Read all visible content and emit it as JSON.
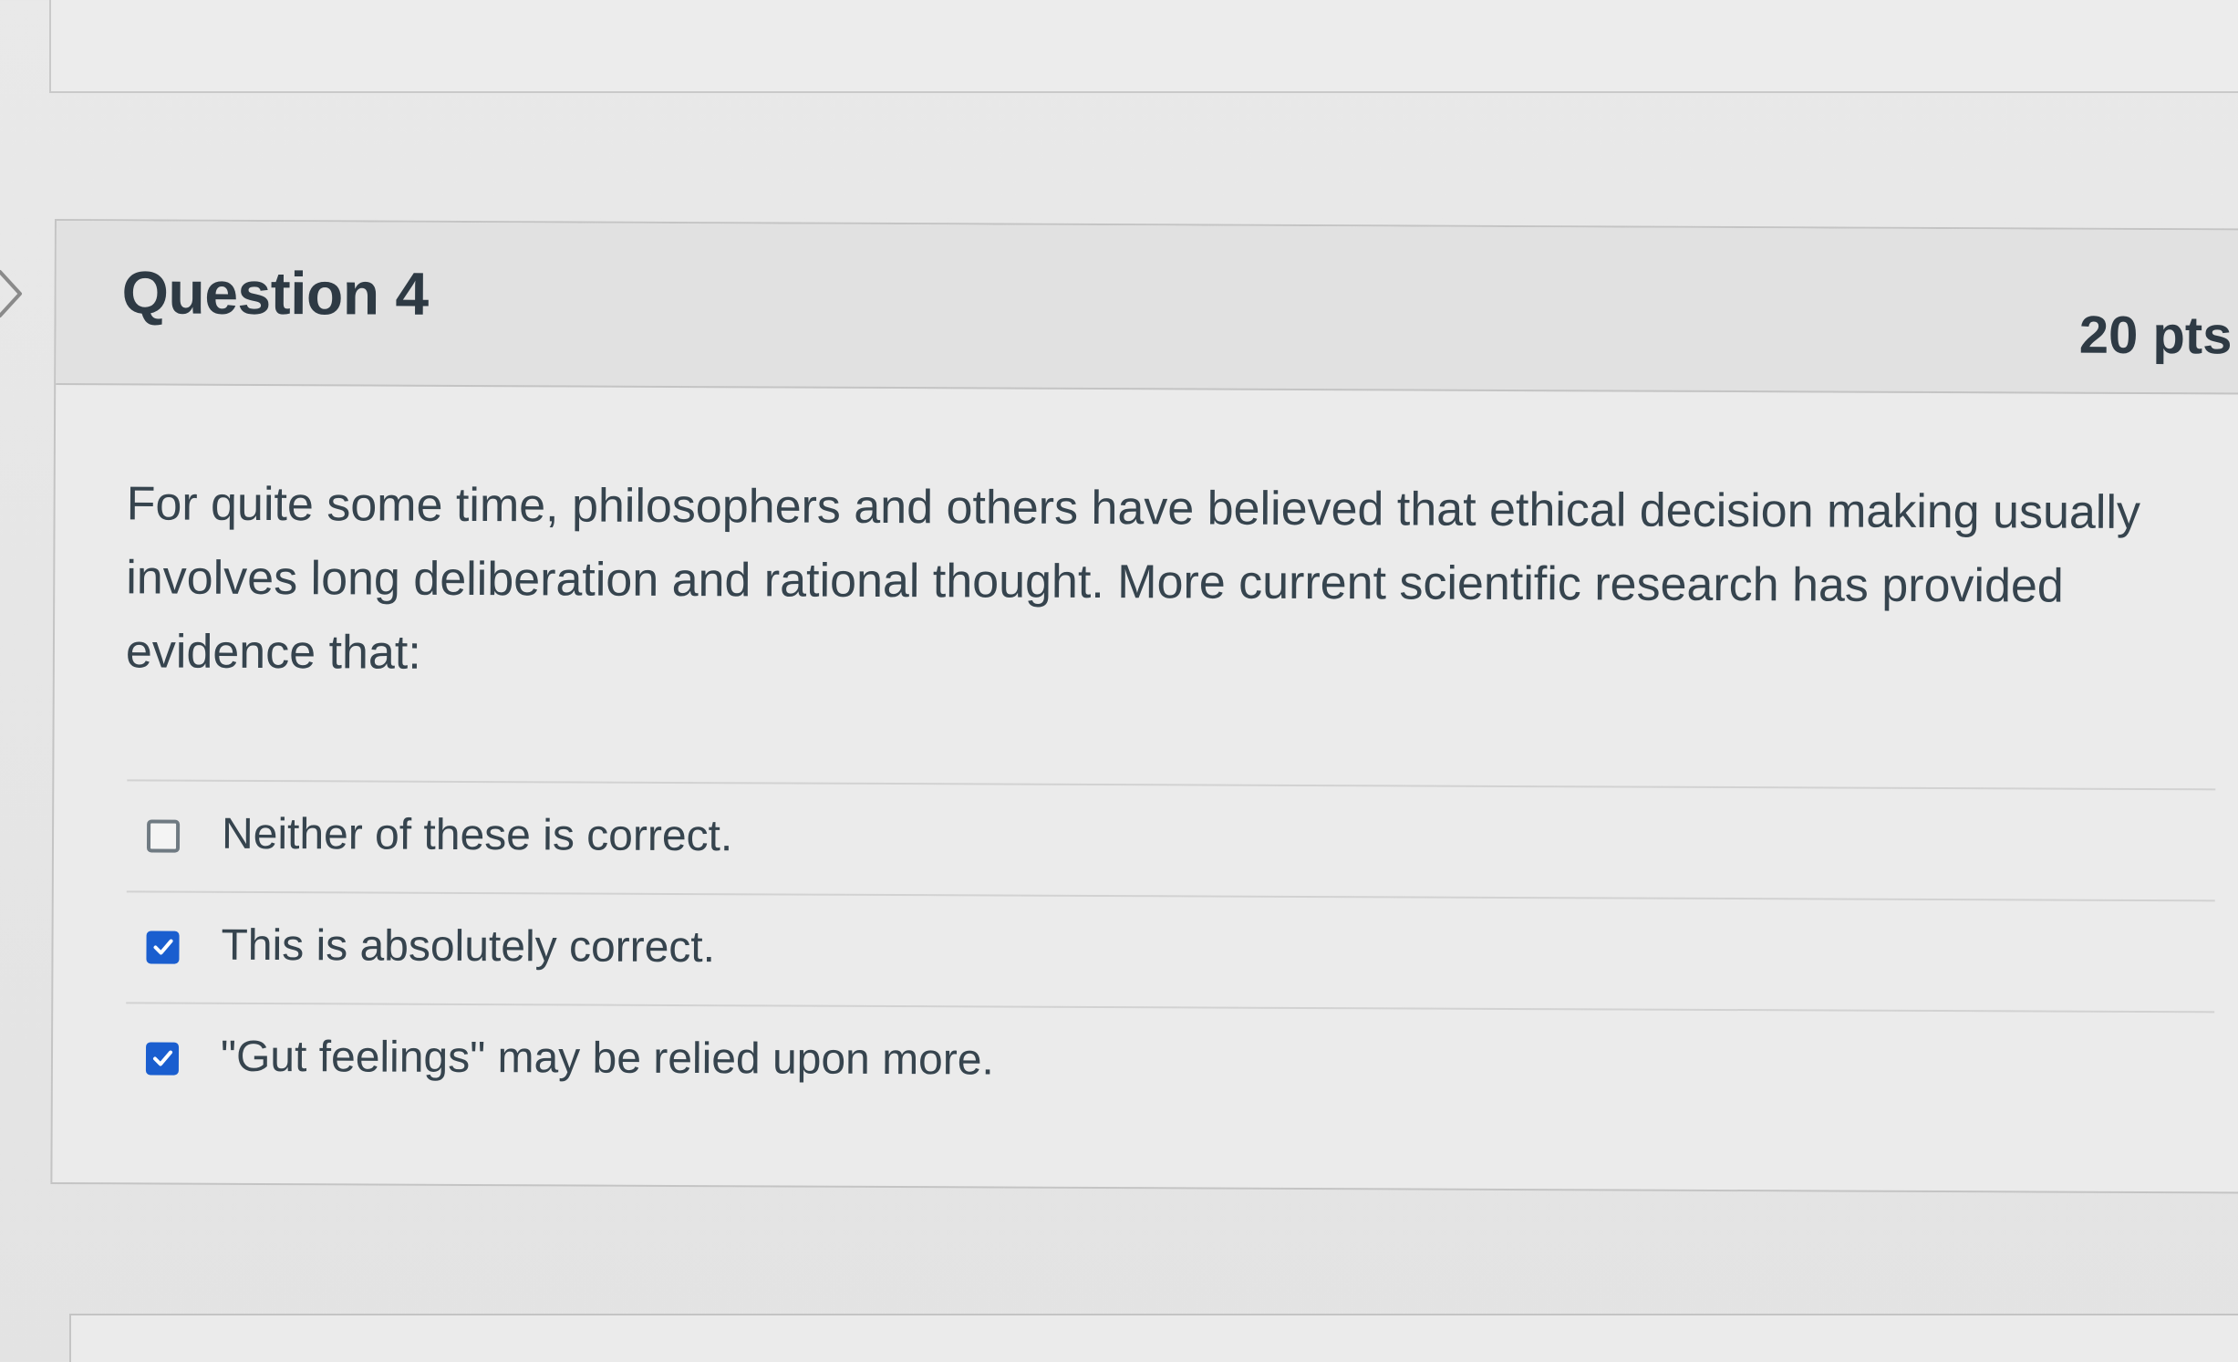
{
  "question": {
    "title": "Question 4",
    "points": "20 pts",
    "text": "For quite some time, philosophers and others have believed that ethical decision making usually involves long deliberation and rational thought.  More current scientific research has provided evidence that:"
  },
  "answers": [
    {
      "label": "Neither of these is correct.",
      "checked": false
    },
    {
      "label": "This is absolutely correct.",
      "checked": true
    },
    {
      "label": "\"Gut feelings\" may be relied upon more.",
      "checked": true
    }
  ],
  "icons": {
    "nav": "chevron-right-icon",
    "checkbox": "checkmark-icon"
  },
  "colors": {
    "checkbox_checked": "#1a5ecf",
    "text": "#2d3b45",
    "header_bg": "#e1e1e1"
  }
}
